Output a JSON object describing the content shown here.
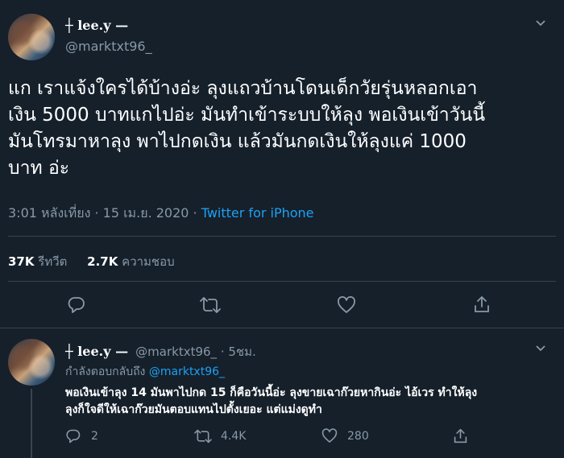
{
  "main_tweet": {
    "display_name": "┼ lee.y —",
    "handle": "@marktxt96_",
    "lines": [
      "แก เราแจ้งใครได้บ้างอ่ะ ลุงแถวบ้านโดนเด็กวัยรุ่นหลอกเอา",
      "เงิน 5000 บาทแกไปอ่ะ มันทำเข้าระบบให้ลุง พอเงินเข้าวันนี้",
      "มันโทรมาหาลุง พาไปกดเงิน แล้วมันกดเงินให้ลุงแค่ 1000",
      "บาท อ่ะ"
    ],
    "time": "3:01 หลังเที่ยง · 15 เม.ย. 2020 · ",
    "source": "Twitter for iPhone",
    "retweets_count": "37K",
    "retweets_label": "รีทวีต",
    "likes_count": "2.7K",
    "likes_label": "ความชอบ"
  },
  "reply_tweet": {
    "display_name": "┼ lee.y —",
    "handle_time": "@marktxt96_ · 5ชม.",
    "replying_prefix": "กำลังตอบกลับถึง",
    "replying_to": "@marktxt96_",
    "lines": [
      "พอเงินเข้าลุง 14 มันพาไปกด 15 ก็คือวันนี้อ่ะ ลุงขายเฉาก๊วยหากินอ่ะ ไอ้เวร ทำให้ลุง",
      "ลุงก็ใจดีให้เฉาก๊วยมันตอบแทนไปตั้งเยอะ แต่แม่งดูทำ"
    ],
    "reply_count": "2",
    "retweet_count": "4.4K",
    "like_count": "280"
  },
  "colors": {
    "background": "#15202b",
    "muted": "#8899a6",
    "link": "#1da1f2",
    "divider": "#38444d"
  }
}
